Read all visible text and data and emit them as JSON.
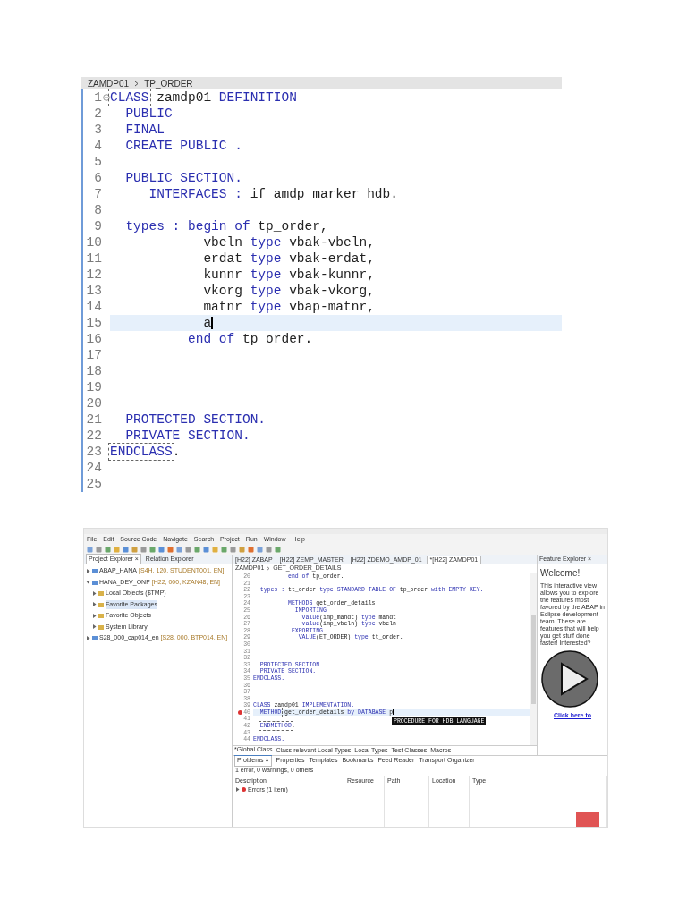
{
  "top_editor": {
    "breadcrumb": [
      "ZAMDP01",
      "TP_ORDER"
    ],
    "lines": [
      {
        "number": "1",
        "current": false,
        "fold": true,
        "tokens": [
          {
            "text": "CLASS",
            "kind": "matched"
          },
          {
            "text": " zamdp01 ",
            "kind": "plain"
          },
          {
            "text": "DEFINITION",
            "kind": "keyword"
          }
        ]
      },
      {
        "number": "2",
        "current": false,
        "fold": false,
        "tokens": [
          {
            "text": "  PUBLIC",
            "kind": "keyword"
          }
        ]
      },
      {
        "number": "3",
        "current": false,
        "fold": false,
        "tokens": [
          {
            "text": "  FINAL",
            "kind": "keyword"
          }
        ]
      },
      {
        "number": "4",
        "current": false,
        "fold": false,
        "tokens": [
          {
            "text": "  CREATE PUBLIC .",
            "kind": "keyword"
          }
        ]
      },
      {
        "number": "5",
        "current": false,
        "fold": false
      },
      {
        "number": "6",
        "current": false,
        "fold": false,
        "tokens": [
          {
            "text": "  PUBLIC SECTION.",
            "kind": "keyword"
          }
        ]
      },
      {
        "number": "7",
        "current": false,
        "fold": false,
        "tokens": [
          {
            "text": "     INTERFACES :",
            "kind": "keyword"
          },
          {
            "text": " if_amdp_marker_hdb.",
            "kind": "plain"
          }
        ]
      },
      {
        "number": "8",
        "current": false,
        "fold": false
      },
      {
        "number": "9",
        "current": false,
        "fold": false,
        "tokens": [
          {
            "text": "  types : begin of",
            "kind": "keyword"
          },
          {
            "text": " tp_order,",
            "kind": "plain"
          }
        ]
      },
      {
        "number": "10",
        "current": false,
        "fold": false,
        "tokens": [
          {
            "text": "            vbeln ",
            "kind": "plain"
          },
          {
            "text": "type",
            "kind": "keyword"
          },
          {
            "text": " vbak-vbeln,",
            "kind": "plain"
          }
        ]
      },
      {
        "number": "11",
        "current": false,
        "fold": false,
        "tokens": [
          {
            "text": "            erdat ",
            "kind": "plain"
          },
          {
            "text": "type",
            "kind": "keyword"
          },
          {
            "text": " vbak-erdat,",
            "kind": "plain"
          }
        ]
      },
      {
        "number": "12",
        "current": false,
        "fold": false,
        "tokens": [
          {
            "text": "            kunnr ",
            "kind": "plain"
          },
          {
            "text": "type",
            "kind": "keyword"
          },
          {
            "text": " vbak-kunnr,",
            "kind": "plain"
          }
        ]
      },
      {
        "number": "13",
        "current": false,
        "fold": false,
        "tokens": [
          {
            "text": "            vkorg ",
            "kind": "plain"
          },
          {
            "text": "type",
            "kind": "keyword"
          },
          {
            "text": " vbak-vkorg,",
            "kind": "plain"
          }
        ]
      },
      {
        "number": "14",
        "current": false,
        "fold": false,
        "tokens": [
          {
            "text": "            matnr ",
            "kind": "plain"
          },
          {
            "text": "type",
            "kind": "keyword"
          },
          {
            "text": " vbap-matnr,",
            "kind": "plain"
          }
        ]
      },
      {
        "number": "15",
        "current": true,
        "fold": false,
        "tokens": [
          {
            "text": "            a",
            "kind": "plain"
          }
        ]
      },
      {
        "number": "16",
        "current": false,
        "fold": false,
        "tokens": [
          {
            "text": "          end of",
            "kind": "keyword"
          },
          {
            "text": " tp_order.",
            "kind": "plain"
          }
        ]
      },
      {
        "number": "17",
        "current": false,
        "fold": false
      },
      {
        "number": "18",
        "current": false,
        "fold": false
      },
      {
        "number": "19",
        "current": false,
        "fold": false
      },
      {
        "number": "20",
        "current": false,
        "fold": false
      },
      {
        "number": "21",
        "current": false,
        "fold": false,
        "tokens": [
          {
            "text": "  PROTECTED SECTION.",
            "kind": "keyword"
          }
        ]
      },
      {
        "number": "22",
        "current": false,
        "fold": false,
        "tokens": [
          {
            "text": "  PRIVATE SECTION.",
            "kind": "keyword"
          }
        ]
      },
      {
        "number": "23",
        "current": false,
        "fold": false,
        "tokens": [
          {
            "text": "ENDCLASS",
            "kind": "matched"
          },
          {
            "text": ".",
            "kind": "plain"
          }
        ]
      },
      {
        "number": "24",
        "current": false,
        "fold": false
      },
      {
        "number": "25",
        "current": false,
        "fold": false
      }
    ]
  },
  "ide": {
    "menu": [
      "File",
      "Edit",
      "Source Code",
      "Navigate",
      "Search",
      "Project",
      "Run",
      "Window",
      "Help"
    ],
    "explorer_tabs": [
      {
        "label": "Project Explorer ×",
        "selected": true
      },
      {
        "label": "Relation Explorer",
        "selected": false
      }
    ],
    "tree": [
      {
        "label": "ABAP_HANA",
        "detail": "[S4H, 120, STUDENT001, EN]",
        "selected": false,
        "expanded": false
      },
      {
        "label": "HANA_DEV_ONP",
        "detail": "[H22, 000, KZAN48, EN]",
        "selected": false,
        "expanded": true,
        "children": [
          {
            "label": "Local Objects ($TMP)",
            "selected": false,
            "expanded": false
          },
          {
            "label": "Favorite Packages",
            "selected": true,
            "expanded": false
          },
          {
            "label": "Favorite Objects",
            "selected": false,
            "expanded": false
          },
          {
            "label": "System Library",
            "selected": false,
            "expanded": false
          }
        ]
      },
      {
        "label": "S28_000_cap014_en",
        "detail": "[S28, 000, BTP014, EN]",
        "selected": false,
        "expanded": false
      }
    ],
    "editor_tabs": [
      {
        "label": "[H22] ZABAP",
        "selected": false
      },
      {
        "label": "[H22] ZEMP_MASTER",
        "selected": false
      },
      {
        "label": "[H22] ZDEMO_AMDP_01",
        "selected": false
      },
      {
        "label": "*[H22] ZAMDP01",
        "selected": true
      }
    ],
    "breadcrumb": [
      "ZAMDP01",
      "GET_ORDER_DETAILS"
    ],
    "lines": [
      {
        "number": "20",
        "current": false,
        "error": false,
        "tokens": [
          {
            "text": "          end of",
            "kind": "keyword"
          },
          {
            "text": " tp_order.",
            "kind": "plain"
          }
        ]
      },
      {
        "number": "21",
        "current": false,
        "error": false
      },
      {
        "number": "22",
        "current": false,
        "error": false,
        "tokens": [
          {
            "text": "  types : ",
            "kind": "keyword"
          },
          {
            "text": "tt_order ",
            "kind": "plain"
          },
          {
            "text": "type STANDARD TABLE OF",
            "kind": "keyword"
          },
          {
            "text": " tp_order ",
            "kind": "plain"
          },
          {
            "text": "with EMPTY KEY.",
            "kind": "keyword"
          }
        ]
      },
      {
        "number": "23",
        "current": false,
        "error": false
      },
      {
        "number": "24",
        "current": false,
        "error": false,
        "tokens": [
          {
            "text": "          METHODS",
            "kind": "keyword"
          },
          {
            "text": " get_order_details",
            "kind": "plain"
          }
        ]
      },
      {
        "number": "25",
        "current": false,
        "error": false,
        "tokens": [
          {
            "text": "            IMPORTING",
            "kind": "keyword"
          }
        ]
      },
      {
        "number": "26",
        "current": false,
        "error": false,
        "tokens": [
          {
            "text": "              value",
            "kind": "keyword"
          },
          {
            "text": "(imp_mandt) ",
            "kind": "plain"
          },
          {
            "text": "type",
            "kind": "keyword"
          },
          {
            "text": " mandt",
            "kind": "plain"
          }
        ]
      },
      {
        "number": "27",
        "current": false,
        "error": false,
        "tokens": [
          {
            "text": "              value",
            "kind": "keyword"
          },
          {
            "text": "(imp_vbeln) ",
            "kind": "plain"
          },
          {
            "text": "type",
            "kind": "keyword"
          },
          {
            "text": " vbeln",
            "kind": "plain"
          }
        ]
      },
      {
        "number": "28",
        "current": false,
        "error": false,
        "tokens": [
          {
            "text": "           EXPORTING",
            "kind": "keyword"
          }
        ]
      },
      {
        "number": "29",
        "current": false,
        "error": false,
        "tokens": [
          {
            "text": "             VALUE",
            "kind": "keyword"
          },
          {
            "text": "(ET_ORDER) ",
            "kind": "plain"
          },
          {
            "text": "type",
            "kind": "keyword"
          },
          {
            "text": " tt_order.",
            "kind": "plain"
          }
        ]
      },
      {
        "number": "30",
        "current": false,
        "error": false
      },
      {
        "number": "31",
        "current": false,
        "error": false
      },
      {
        "number": "32",
        "current": false,
        "error": false
      },
      {
        "number": "33",
        "current": false,
        "error": false,
        "tokens": [
          {
            "text": "  PROTECTED SECTION.",
            "kind": "keyword"
          }
        ]
      },
      {
        "number": "34",
        "current": false,
        "error": false,
        "tokens": [
          {
            "text": "  PRIVATE SECTION.",
            "kind": "keyword"
          }
        ]
      },
      {
        "number": "35",
        "current": false,
        "error": false,
        "tokens": [
          {
            "text": "ENDCLASS.",
            "kind": "keyword"
          }
        ]
      },
      {
        "number": "36",
        "current": false,
        "error": false
      },
      {
        "number": "37",
        "current": false,
        "error": false
      },
      {
        "number": "38",
        "current": false,
        "error": false
      },
      {
        "number": "39",
        "current": false,
        "error": false,
        "tokens": [
          {
            "text": "CLASS",
            "kind": "keyword"
          },
          {
            "text": " zamdp01 ",
            "kind": "plain"
          },
          {
            "text": "IMPLEMENTATION.",
            "kind": "keyword"
          }
        ]
      },
      {
        "number": "40",
        "current": true,
        "error": true,
        "tokens": [
          {
            "text": "METHOD",
            "kind": "matched"
          },
          {
            "text": " get_order_details ",
            "kind": "plain"
          },
          {
            "text": "by DATABASE",
            "kind": "keyword"
          },
          {
            "text": " p",
            "kind": "plain"
          }
        ]
      },
      {
        "number": "41",
        "current": false,
        "error": false
      },
      {
        "number": "42",
        "current": false,
        "error": false,
        "tokens": [
          {
            "text": "ENDMETHOD",
            "kind": "matched"
          },
          {
            "text": ".",
            "kind": "plain"
          }
        ]
      },
      {
        "number": "43",
        "current": false,
        "error": false
      },
      {
        "number": "44",
        "current": false,
        "error": false,
        "tokens": [
          {
            "text": "ENDCLASS.",
            "kind": "keyword"
          }
        ]
      }
    ],
    "tooltip": "PROCEDURE FOR HDB LANGUAGE",
    "class_tabs": [
      {
        "label": "*Global Class",
        "selected": true
      },
      {
        "label": "Class-relevant Local Types",
        "selected": false
      },
      {
        "label": "Local Types",
        "selected": false
      },
      {
        "label": "Test Classes",
        "selected": false
      },
      {
        "label": "Macros",
        "selected": false
      }
    ],
    "feature_explorer": {
      "tab": "Feature Explorer ×",
      "heading": "Welcome!",
      "text": "This interactive view allows you to explore the features most favored by the ABAP in Eclipse development team. These are features that will help you get stuff done faster! Interested?",
      "link": "Click here to"
    },
    "problem_tabs": [
      {
        "label": "Problems ×",
        "selected": true
      },
      {
        "label": "Properties",
        "selected": false
      },
      {
        "label": "Templates",
        "selected": false
      },
      {
        "label": "Bookmarks",
        "selected": false
      },
      {
        "label": "Feed Reader",
        "selected": false
      },
      {
        "label": "Transport Organizer",
        "selected": false
      }
    ],
    "problem_summary": "1 error, 0 warnings, 0 others",
    "problem_columns": [
      "Description",
      "Resource",
      "Path",
      "Location",
      "Type"
    ],
    "problem_rows": [
      {
        "description": "Errors (1 item)",
        "expanded": false
      }
    ]
  }
}
